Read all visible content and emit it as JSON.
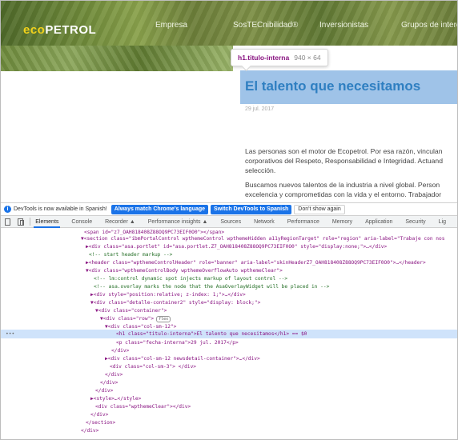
{
  "site": {
    "logo_prefix": "eco",
    "logo_suffix": "PETROL",
    "nav": [
      "Empresa",
      "SosTECnibilidad®",
      "Inversionistas",
      "Grupos de interés"
    ],
    "tooltip_tag": "h1.titulo-interna",
    "tooltip_dims": "940 × 64",
    "title": "El talento que necesitamos",
    "date": "29 jul. 2017",
    "paragraphs": [
      "Las personas son el motor de Ecopetrol. Por esa razón, vinculan",
      "corporativos del Respeto, Responsabilidad e Integridad. Actuand",
      "selección.",
      "Buscamos nuevos talentos de la industria a nivel global. Person",
      "excelencia y comprometidas con la vida y el entorno. Trabajador"
    ]
  },
  "infobar": {
    "icon": "info-icon",
    "text": "DevTools is now available in Spanish!",
    "btn_match": "Always match Chrome's language",
    "btn_switch": "Switch DevTools to Spanish",
    "btn_dismiss": "Don't show again"
  },
  "tabs": [
    "Elements",
    "Console",
    "Recorder ▲",
    "Performance insights ▲",
    "Sources",
    "Network",
    "Performance",
    "Memory",
    "Application",
    "Security",
    "Lig"
  ],
  "dom": {
    "l0": "<span id=\"z7_OAH818408Z88OQ9PC73EIF0O0\"></span>",
    "l1": "▼<section class=\"ibmPortalControl wpthemeControl wpthemeHidden a11yRegionTarget\" role=\"region\" aria-label=\"Trabaje con nos",
    "l2": "▶<div class=\"asa.portlet\" id=\"asa.portlet.Z7_OAH818408Z88OQ9PC73EIF0O0\" style=\"display:none;\">…</div>",
    "l3": "<!-- start header markup -->",
    "l4": "▶<header class=\"wpthemeControlHeader\" role=\"banner\" aria-label=\"skinHeaderZ7_OAH818408Z88OQ9PC73EIF0O0\">…</header>",
    "l5": "▼<div class=\"wpthemeControlBody wpthemeOverflowAuto wpthemeClear\">",
    "l6": "<!-- lm:control dynamic spot injects markup of layout control -->",
    "l7": "<!-- asa.overlay marks the node that the AsaOverlayWidget will be placed in -->",
    "l8": "▶<div style=\"position:relative; z-index: 1;\">…</div>",
    "l9": "▼<div class=\"detalle-container2\" style=\"display: block;\">",
    "l10": "▼<div class=\"container\">",
    "l11": "▼<div class=\"row\">",
    "l11_badge": "flex",
    "l12": "▼<div class=\"col-sm-12\">",
    "l13": "<h1 class=\"titulo-interna\">El talento que necesitamos</h1> == $0",
    "l14": "<p class=\"fecha-interna\">29 jul. 2017</p>",
    "l15": "</div>",
    "l16": "▶<div class=\"col-sm-12 newsdetail-container\">…</div>",
    "l17": "<div class=\"col-sm-3\"> </div>",
    "l18": "</div>",
    "l19": "</div>",
    "l20": "</div>",
    "l21": "▶<style>…</style>",
    "l22": "<div class=\"wpthemeClear\"></div>",
    "l23": "</div>",
    "l24": "</section>",
    "l25": "</div>"
  }
}
